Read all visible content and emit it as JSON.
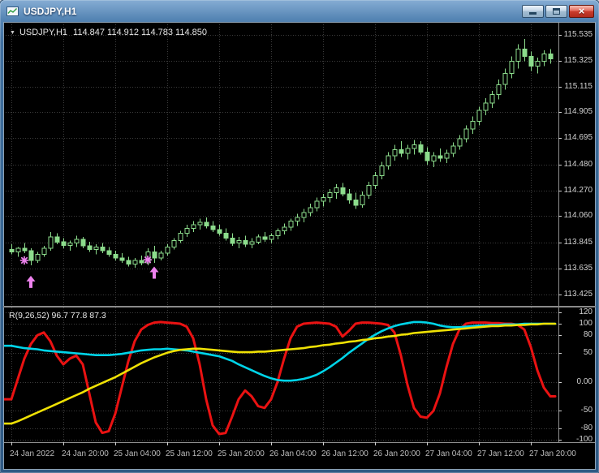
{
  "window": {
    "title": "USDJPY,H1",
    "controls": {
      "close_glyph": "×"
    }
  },
  "chart": {
    "header": {
      "collapse_glyph": "▼",
      "symbol": "USDJPY,H1",
      "ohlc": "114.847 114.912 114.783 114.850"
    }
  },
  "indicator": {
    "label": "R(9,26,52) 96.7 77.8 87.3"
  },
  "colors": {
    "background": "#000000",
    "grid": "#3d3d3d",
    "candle": "#8cdc8c",
    "signal": "#ee82ee",
    "frame": "#909090",
    "axis_text": "#d0d0d0"
  },
  "chart_data": [
    {
      "type": "candlestick",
      "symbol": "USDJPY",
      "timeframe": "H1",
      "ylim": [
        113.33,
        115.64
      ],
      "y_tick_labels": [
        "115.535",
        "115.325",
        "115.115",
        "114.905",
        "114.695",
        "114.480",
        "114.270",
        "114.060",
        "113.845",
        "113.635",
        "113.425"
      ],
      "x_labels": [
        "24 Jan 2022",
        "24 Jan 20:00",
        "25 Jan 04:00",
        "25 Jan 12:00",
        "25 Jan 20:00",
        "26 Jan 04:00",
        "26 Jan 12:00",
        "26 Jan 20:00",
        "27 Jan 04:00",
        "27 Jan 12:00",
        "27 Jan 20:00"
      ],
      "bars_per_label": 8,
      "candles": [
        [
          113.79,
          113.83,
          113.75,
          113.77
        ],
        [
          113.77,
          113.81,
          113.73,
          113.8
        ],
        [
          113.8,
          113.84,
          113.76,
          113.78
        ],
        [
          113.78,
          113.8,
          113.66,
          113.7
        ],
        [
          113.7,
          113.77,
          113.68,
          113.75
        ],
        [
          113.75,
          113.82,
          113.73,
          113.8
        ],
        [
          113.8,
          113.93,
          113.78,
          113.89
        ],
        [
          113.89,
          113.92,
          113.83,
          113.85
        ],
        [
          113.85,
          113.88,
          113.8,
          113.82
        ],
        [
          113.82,
          113.86,
          113.78,
          113.84
        ],
        [
          113.84,
          113.9,
          113.81,
          113.87
        ],
        [
          113.87,
          113.89,
          113.8,
          113.82
        ],
        [
          113.82,
          113.85,
          113.77,
          113.79
        ],
        [
          113.79,
          113.83,
          113.75,
          113.81
        ],
        [
          113.81,
          113.84,
          113.76,
          113.78
        ],
        [
          113.78,
          113.81,
          113.73,
          113.75
        ],
        [
          113.75,
          113.78,
          113.7,
          113.72
        ],
        [
          113.72,
          113.76,
          113.68,
          113.7
        ],
        [
          113.7,
          113.73,
          113.65,
          113.67
        ],
        [
          113.67,
          113.72,
          113.64,
          113.7
        ],
        [
          113.7,
          113.74,
          113.66,
          113.68
        ],
        [
          113.68,
          113.8,
          113.66,
          113.77
        ],
        [
          113.77,
          113.82,
          113.68,
          113.72
        ],
        [
          113.72,
          113.78,
          113.7,
          113.76
        ],
        [
          113.76,
          113.83,
          113.74,
          113.81
        ],
        [
          113.81,
          113.88,
          113.79,
          113.86
        ],
        [
          113.86,
          113.94,
          113.84,
          113.92
        ],
        [
          113.92,
          113.99,
          113.89,
          113.96
        ],
        [
          113.96,
          114.02,
          113.93,
          113.99
        ],
        [
          113.99,
          114.04,
          113.95,
          114.01
        ],
        [
          114.01,
          114.05,
          113.96,
          113.98
        ],
        [
          113.98,
          114.02,
          113.93,
          113.95
        ],
        [
          113.95,
          113.99,
          113.9,
          113.92
        ],
        [
          113.92,
          113.96,
          113.86,
          113.88
        ],
        [
          113.88,
          113.92,
          113.82,
          113.84
        ],
        [
          113.84,
          113.89,
          113.8,
          113.86
        ],
        [
          113.86,
          113.9,
          113.81,
          113.83
        ],
        [
          113.83,
          113.88,
          113.8,
          113.85
        ],
        [
          113.85,
          113.91,
          113.83,
          113.89
        ],
        [
          113.89,
          113.93,
          113.85,
          113.87
        ],
        [
          113.87,
          113.92,
          113.84,
          113.9
        ],
        [
          113.9,
          113.96,
          113.87,
          113.94
        ],
        [
          113.94,
          114.0,
          113.91,
          113.97
        ],
        [
          113.97,
          114.04,
          113.94,
          114.02
        ],
        [
          114.02,
          114.08,
          113.98,
          114.05
        ],
        [
          114.05,
          114.12,
          114.01,
          114.09
        ],
        [
          114.09,
          114.16,
          114.06,
          114.13
        ],
        [
          114.13,
          114.21,
          114.1,
          114.18
        ],
        [
          114.18,
          114.24,
          114.14,
          114.21
        ],
        [
          114.21,
          114.28,
          114.17,
          114.25
        ],
        [
          114.25,
          114.32,
          114.2,
          114.29
        ],
        [
          114.29,
          114.33,
          114.22,
          114.24
        ],
        [
          114.24,
          114.28,
          114.16,
          114.19
        ],
        [
          114.19,
          114.25,
          114.12,
          114.15
        ],
        [
          114.15,
          114.26,
          114.13,
          114.23
        ],
        [
          114.23,
          114.34,
          114.2,
          114.31
        ],
        [
          114.31,
          114.42,
          114.28,
          114.39
        ],
        [
          114.39,
          114.5,
          114.36,
          114.47
        ],
        [
          114.47,
          114.58,
          114.44,
          114.55
        ],
        [
          114.55,
          114.64,
          114.51,
          114.6
        ],
        [
          114.6,
          114.67,
          114.54,
          114.57
        ],
        [
          114.57,
          114.64,
          114.52,
          114.61
        ],
        [
          114.61,
          114.68,
          114.56,
          114.64
        ],
        [
          114.64,
          114.67,
          114.56,
          114.58
        ],
        [
          114.58,
          114.62,
          114.48,
          114.51
        ],
        [
          114.51,
          114.58,
          114.46,
          114.55
        ],
        [
          114.55,
          114.61,
          114.5,
          114.53
        ],
        [
          114.53,
          114.6,
          114.49,
          114.57
        ],
        [
          114.57,
          114.66,
          114.54,
          114.63
        ],
        [
          114.63,
          114.72,
          114.6,
          114.69
        ],
        [
          114.69,
          114.8,
          114.66,
          114.77
        ],
        [
          114.77,
          114.87,
          114.73,
          114.83
        ],
        [
          114.83,
          114.95,
          114.8,
          114.92
        ],
        [
          114.92,
          115.02,
          114.88,
          114.98
        ],
        [
          114.98,
          115.08,
          114.94,
          115.05
        ],
        [
          115.05,
          115.17,
          115.01,
          115.13
        ],
        [
          115.13,
          115.26,
          115.09,
          115.22
        ],
        [
          115.22,
          115.36,
          115.18,
          115.32
        ],
        [
          115.32,
          115.46,
          115.26,
          115.42
        ],
        [
          115.42,
          115.5,
          115.32,
          115.36
        ],
        [
          115.36,
          115.4,
          115.24,
          115.28
        ],
        [
          115.28,
          115.35,
          115.22,
          115.32
        ],
        [
          115.32,
          115.41,
          115.28,
          115.38
        ],
        [
          115.38,
          115.42,
          115.3,
          115.34
        ]
      ],
      "signals": [
        {
          "type": "star",
          "bar": 2,
          "price": 113.7
        },
        {
          "type": "arrow_up",
          "bar": 3,
          "price": 113.575
        },
        {
          "type": "star",
          "bar": 21,
          "price": 113.705
        },
        {
          "type": "arrow_up",
          "bar": 22,
          "price": 113.65
        }
      ]
    },
    {
      "type": "line",
      "name": "R(9,26,52)",
      "current_values": [
        96.7,
        77.8,
        87.3
      ],
      "ylim": [
        -104,
        128
      ],
      "y_tick_labels": [
        "120",
        "100",
        "80",
        "50",
        "0.00",
        "-50",
        "-80",
        "-100"
      ],
      "series": [
        {
          "name": "line1",
          "color": "#ea1212",
          "width": 3,
          "values": [
            -30,
            5,
            40,
            65,
            80,
            85,
            70,
            45,
            30,
            40,
            45,
            30,
            -20,
            -70,
            -88,
            -85,
            -55,
            -10,
            35,
            70,
            90,
            98,
            102,
            103,
            102,
            101,
            100,
            95,
            75,
            30,
            -30,
            -75,
            -90,
            -88,
            -60,
            -30,
            -15,
            -25,
            -42,
            -45,
            -30,
            0,
            40,
            75,
            95,
            100,
            101,
            102,
            101,
            100,
            95,
            78,
            88,
            100,
            102,
            102,
            101,
            100,
            98,
            85,
            45,
            -5,
            -45,
            -60,
            -62,
            -50,
            -20,
            25,
            65,
            90,
            100,
            102,
            102,
            102,
            101,
            101,
            100,
            100,
            98,
            90,
            60,
            20,
            -10,
            -25
          ]
        },
        {
          "name": "line2",
          "color": "#00d4e8",
          "width": 2.6,
          "values": [
            62,
            60,
            58,
            57,
            56,
            54,
            53,
            52,
            51,
            50,
            49,
            48,
            47,
            46,
            46,
            46,
            47,
            48,
            50,
            52,
            54,
            55,
            56,
            56,
            57,
            56,
            55,
            54,
            52,
            50,
            48,
            46,
            44,
            40,
            36,
            30,
            25,
            20,
            15,
            10,
            6,
            3,
            2,
            2,
            3,
            5,
            8,
            12,
            18,
            25,
            33,
            41,
            50,
            58,
            66,
            74,
            81,
            87,
            92,
            96,
            99,
            101,
            103,
            103,
            102,
            100,
            97,
            95,
            94,
            94,
            95,
            96,
            97,
            97,
            98,
            98,
            99,
            99,
            99,
            100,
            100,
            100,
            100,
            100
          ]
        },
        {
          "name": "line3",
          "color": "#efe104",
          "width": 2.6,
          "values": [
            -72,
            -68,
            -63,
            -58,
            -53,
            -48,
            -43,
            -38,
            -33,
            -28,
            -23,
            -18,
            -12,
            -7,
            -2,
            3,
            8,
            14,
            20,
            26,
            32,
            37,
            42,
            46,
            50,
            53,
            55,
            56,
            57,
            57,
            56,
            55,
            54,
            53,
            52,
            51,
            51,
            51,
            52,
            52,
            53,
            54,
            55,
            56,
            57,
            58,
            60,
            61,
            63,
            64,
            66,
            67,
            69,
            70,
            72,
            73,
            75,
            76,
            78,
            79,
            81,
            82,
            84,
            85,
            86,
            87,
            88,
            89,
            90,
            91,
            92,
            93,
            94,
            95,
            96,
            96,
            97,
            97,
            98,
            98,
            99,
            99,
            100,
            100
          ]
        }
      ]
    }
  ]
}
